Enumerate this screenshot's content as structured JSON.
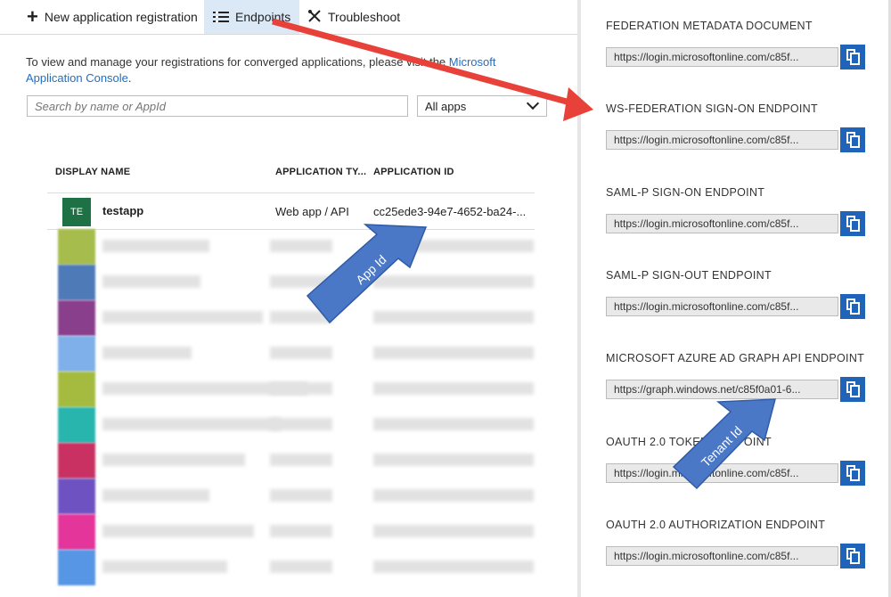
{
  "toolbar": {
    "new_label": "New application registration",
    "endpoints_label": "Endpoints",
    "troubleshoot_label": "Troubleshoot"
  },
  "intro": {
    "text": "To view and manage your registrations for converged applications, please visit the ",
    "link": "Microsoft Application Console",
    "end": "."
  },
  "search": {
    "placeholder": "Search by name or AppId"
  },
  "filter": {
    "selected": "All apps"
  },
  "table": {
    "headers": [
      "DISPLAY NAME",
      "APPLICATION TY...",
      "APPLICATION ID"
    ],
    "first_row": {
      "avatar": "TE",
      "name": "testapp",
      "type": "Web app / API",
      "app_id": "cc25ede3-94e7-4652-ba24-..."
    },
    "obscured_rows": [
      {
        "color": "#a6bd4d"
      },
      {
        "color": "#4f7ab8"
      },
      {
        "color": "#8a3f8c"
      },
      {
        "color": "#7fb0ea"
      },
      {
        "color": "#a4bb40"
      },
      {
        "color": "#28b5ad"
      },
      {
        "color": "#c93163"
      },
      {
        "color": "#6f52c2"
      },
      {
        "color": "#e4359a"
      },
      {
        "color": "#5796e4"
      }
    ]
  },
  "endpoints": [
    {
      "label": "FEDERATION METADATA DOCUMENT",
      "value": "https://login.microsoftonline.com/c85f..."
    },
    {
      "label": "WS-FEDERATION SIGN-ON ENDPOINT",
      "value": "https://login.microsoftonline.com/c85f..."
    },
    {
      "label": "SAML-P SIGN-ON ENDPOINT",
      "value": "https://login.microsoftonline.com/c85f..."
    },
    {
      "label": "SAML-P SIGN-OUT ENDPOINT",
      "value": "https://login.microsoftonline.com/c85f..."
    },
    {
      "label": "MICROSOFT AZURE AD GRAPH API ENDPOINT",
      "value": "https://graph.windows.net/c85f0a01-6..."
    },
    {
      "label": "OAUTH 2.0 TOKEN ENDPOINT",
      "value": "https://login.microsoftonline.com/c85f..."
    },
    {
      "label": "OAUTH 2.0 AUTHORIZATION ENDPOINT",
      "value": "https://login.microsoftonline.com/c85f..."
    }
  ],
  "annotations": {
    "app_id_callout": "App Id",
    "tenant_id_callout": "Tenant Id",
    "arrow_color": "#e8413a",
    "callout_color": "#4a78c6"
  }
}
